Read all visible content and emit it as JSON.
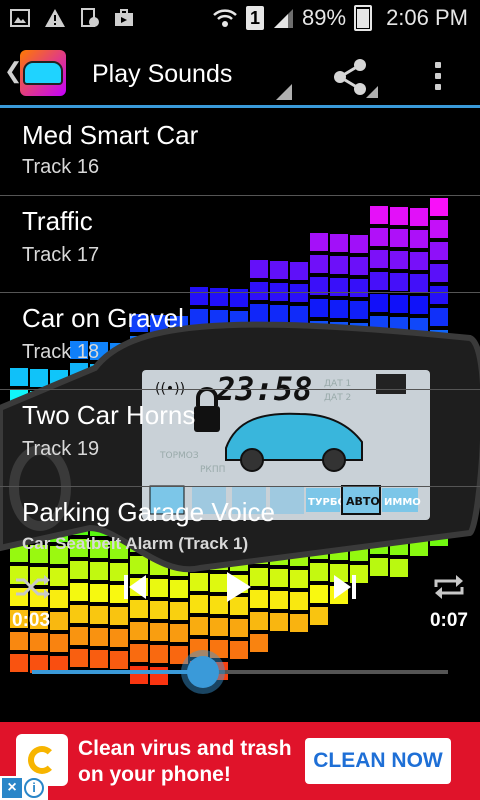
{
  "status_bar": {
    "icons": [
      "image-icon",
      "warning-icon",
      "data-icon",
      "briefcase-icon",
      "wifi-icon",
      "sim-icon",
      "signal-icon"
    ],
    "sim_label": "1",
    "battery": "89%",
    "time": "2:06 PM"
  },
  "app_bar": {
    "title": "Play Sounds"
  },
  "tracks": [
    {
      "title": "Med Smart Car",
      "subtitle": "Track 16"
    },
    {
      "title": "Traffic",
      "subtitle": "Track 17"
    },
    {
      "title": "Car on Gravel",
      "subtitle": "Track 18"
    },
    {
      "title": "Two Car Horns",
      "subtitle": "Track 19"
    },
    {
      "title": "Parking Garage Voice",
      "subtitle": ""
    }
  ],
  "background_art": {
    "display_time": "23:58",
    "labels": [
      "ДАТ 1",
      "ДАТ 2",
      "ТОРМОЗ",
      "РКПП",
      "ТУРБО",
      "АВТО",
      "ИММО"
    ]
  },
  "player": {
    "now_playing": "Car Seatbelt Alarm (Track 1)",
    "elapsed": "0:03",
    "duration": "0:07",
    "progress": 0.41,
    "accent": "#3a9ad9"
  },
  "ad": {
    "text": "Clean virus and trash on your phone!",
    "cta": "CLEAN NOW",
    "background": "#e0132a"
  }
}
